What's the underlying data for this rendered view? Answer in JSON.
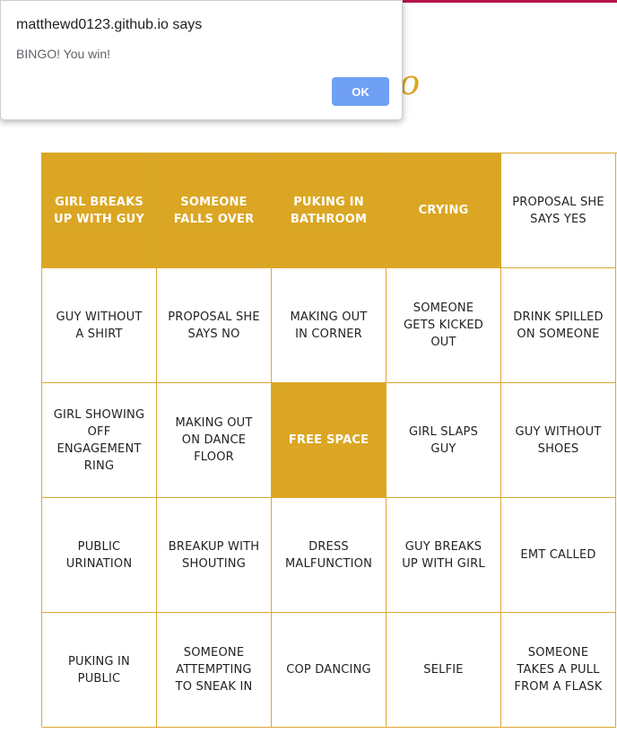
{
  "page": {
    "logo_text": "go",
    "accent_color": "#dba623",
    "header_bar_color": "#b5124a"
  },
  "dialog": {
    "title": "matthewd0123.github.io says",
    "message": "BINGO! You win!",
    "ok_label": "OK"
  },
  "board": {
    "cells": [
      {
        "text": "GIRL BREAKS UP WITH GUY",
        "marked": true
      },
      {
        "text": "SOMEONE FALLS OVER",
        "marked": true
      },
      {
        "text": "PUKING IN BATHROOM",
        "marked": true
      },
      {
        "text": "CRYING",
        "marked": true
      },
      {
        "text": "PROPOSAL SHE SAYS YES",
        "marked": false
      },
      {
        "text": "GUY WITHOUT A SHIRT",
        "marked": false
      },
      {
        "text": "PROPOSAL SHE SAYS NO",
        "marked": false
      },
      {
        "text": "MAKING OUT IN CORNER",
        "marked": false
      },
      {
        "text": "SOMEONE GETS KICKED OUT",
        "marked": false
      },
      {
        "text": "DRINK SPILLED ON SOMEONE",
        "marked": false
      },
      {
        "text": "GIRL SHOWING OFF ENGAGEMENT RING",
        "marked": false
      },
      {
        "text": "MAKING OUT ON DANCE FLOOR",
        "marked": false
      },
      {
        "text": "FREE SPACE",
        "marked": true
      },
      {
        "text": "GIRL SLAPS GUY",
        "marked": false
      },
      {
        "text": "GUY WITHOUT SHOES",
        "marked": false
      },
      {
        "text": "PUBLIC URINATION",
        "marked": false
      },
      {
        "text": "BREAKUP WITH SHOUTING",
        "marked": false
      },
      {
        "text": "DRESS MALFUNCTION",
        "marked": false
      },
      {
        "text": "GUY BREAKS UP WITH GIRL",
        "marked": false
      },
      {
        "text": "EMT CALLED",
        "marked": false
      },
      {
        "text": "PUKING IN PUBLIC",
        "marked": false
      },
      {
        "text": "SOMEONE ATTEMPTING TO SNEAK IN",
        "marked": false
      },
      {
        "text": "COP DANCING",
        "marked": false
      },
      {
        "text": "SELFIE",
        "marked": false
      },
      {
        "text": "SOMEONE TAKES A PULL FROM A FLASK",
        "marked": false
      }
    ]
  }
}
